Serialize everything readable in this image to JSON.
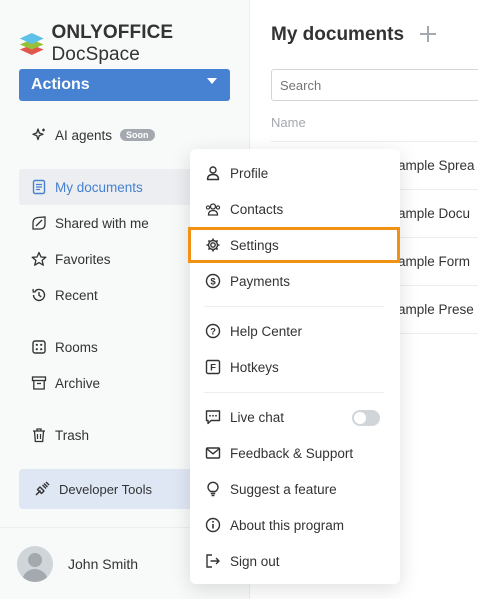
{
  "app": {
    "logo_brand": "ONLYOFFICE",
    "logo_product": "DocSpace",
    "colors": {
      "accent": "#4781d1",
      "highlight": "#f29214"
    }
  },
  "sidebar": {
    "actions_label": "Actions",
    "ai_agents": {
      "label": "AI agents",
      "badge": "Soon",
      "icon": "sparkle-icon"
    },
    "items": [
      {
        "label": "My documents",
        "icon": "document-icon",
        "active": true
      },
      {
        "label": "Shared with me",
        "icon": "shared-icon"
      },
      {
        "label": "Favorites",
        "icon": "star-icon"
      },
      {
        "label": "Recent",
        "icon": "history-icon"
      },
      {
        "label": "Rooms",
        "icon": "rooms-icon"
      },
      {
        "label": "Archive",
        "icon": "archive-icon"
      },
      {
        "label": "Trash",
        "icon": "trash-icon"
      }
    ],
    "developer_tools": "Developer Tools",
    "user_name": "John Smith"
  },
  "main": {
    "title": "My documents",
    "search_placeholder": "Search",
    "column_name": "Name",
    "files": [
      {
        "name": "ample Sprea"
      },
      {
        "name": "ample Docu"
      },
      {
        "name": "ample Form"
      },
      {
        "name": "ample Prese"
      }
    ]
  },
  "menu": {
    "items": [
      {
        "label": "Profile",
        "icon": "profile-icon"
      },
      {
        "label": "Contacts",
        "icon": "contacts-icon"
      },
      {
        "label": "Settings",
        "icon": "gear-icon",
        "highlighted": true
      },
      {
        "label": "Payments",
        "icon": "dollar-icon"
      },
      {
        "label": "Help Center",
        "icon": "help-icon"
      },
      {
        "label": "Hotkeys",
        "icon": "hotkeys-icon"
      },
      {
        "label": "Live chat",
        "icon": "chat-icon",
        "toggle": false
      },
      {
        "label": "Feedback & Support",
        "icon": "mail-icon"
      },
      {
        "label": "Suggest a feature",
        "icon": "bulb-icon"
      },
      {
        "label": "About this program",
        "icon": "info-icon"
      },
      {
        "label": "Sign out",
        "icon": "sign-out-icon"
      }
    ]
  }
}
